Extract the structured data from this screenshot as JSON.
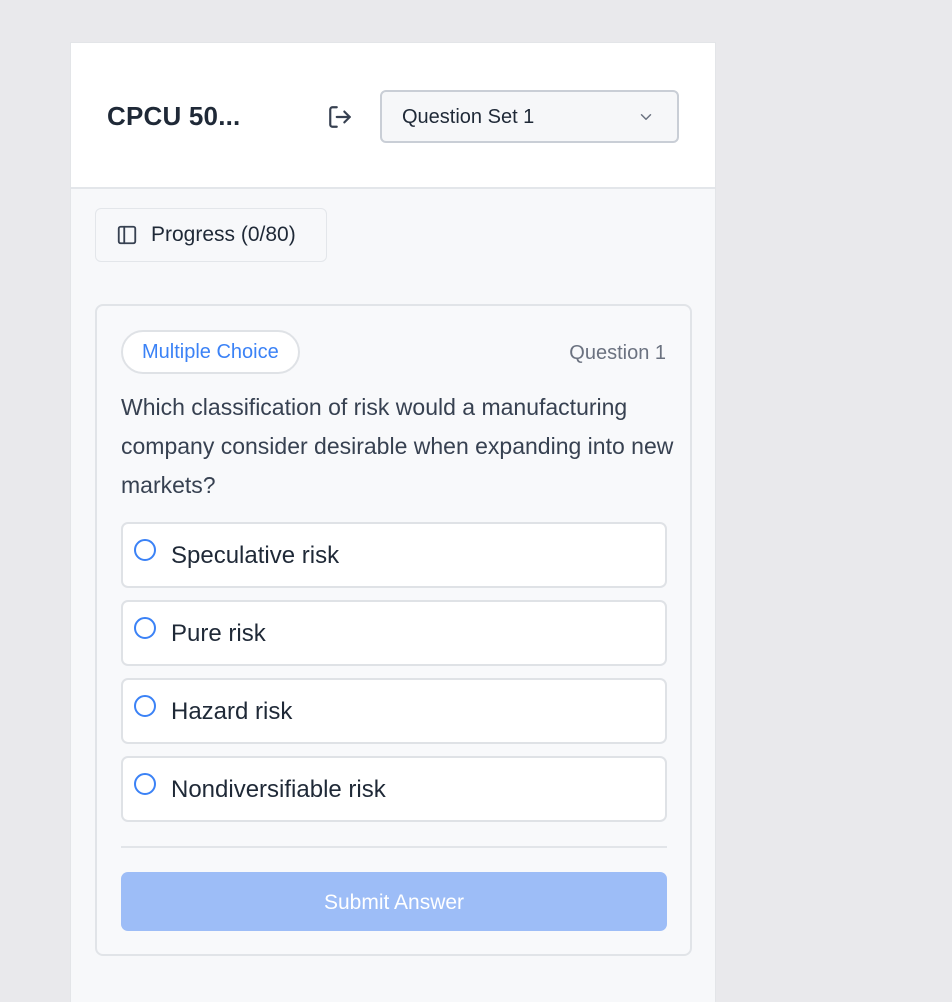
{
  "header": {
    "course_title": "CPCU 50...",
    "question_set_select": {
      "selected": "Question Set 1"
    }
  },
  "progress": {
    "label": "Progress (0/80)"
  },
  "question": {
    "type_badge": "Multiple Choice",
    "number_label": "Question 1",
    "text": "Which classification of risk would a manufacturing company consider desirable when expanding into new markets?",
    "options": [
      {
        "label": "Speculative risk"
      },
      {
        "label": "Pure risk"
      },
      {
        "label": "Hazard risk"
      },
      {
        "label": "Nondiversifiable risk"
      }
    ],
    "submit_label": "Submit Answer"
  },
  "icons": {
    "logout": "logout-icon",
    "chevron": "chevron-down-icon",
    "sidebar": "sidebar-panel-icon"
  },
  "colors": {
    "accent": "#3b82f6",
    "submit_disabled": "#9dbdf7",
    "page_background": "#e9e9ec",
    "card_background": "#f8f9fb"
  }
}
